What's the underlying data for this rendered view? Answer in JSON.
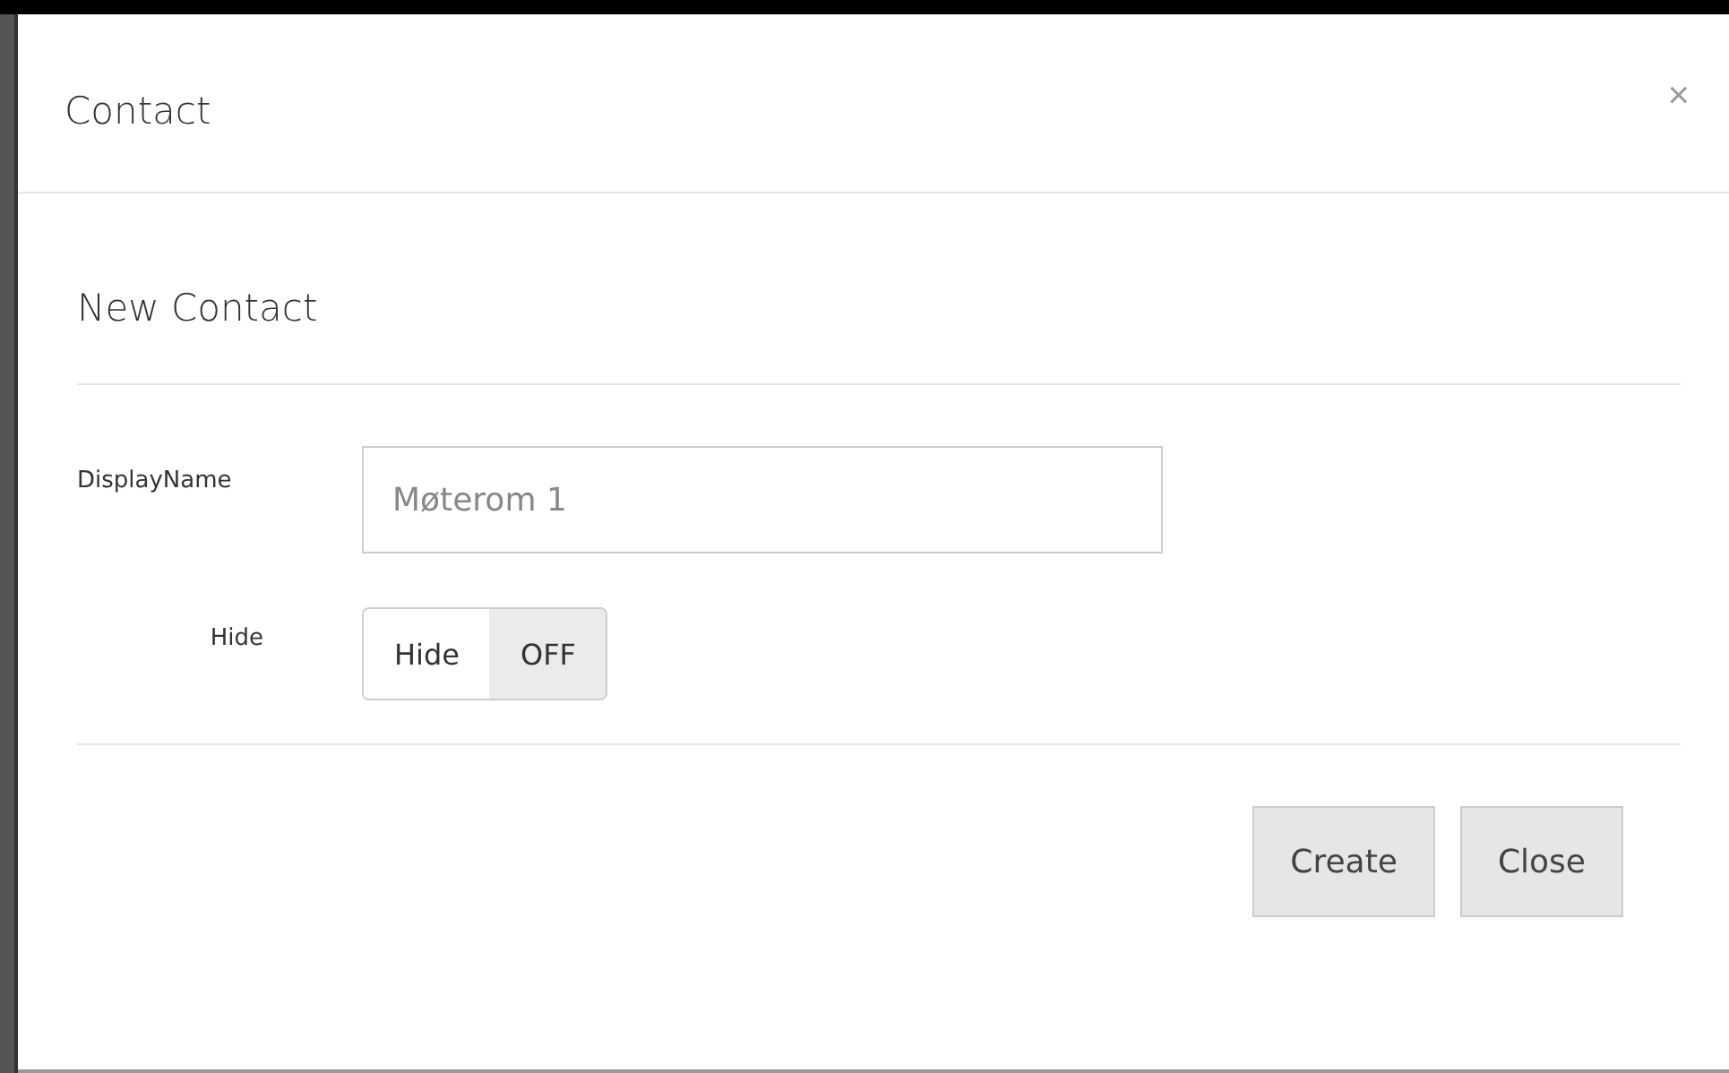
{
  "dialog": {
    "title": "Contact",
    "close": "×",
    "section_title": "New Contact",
    "fields": [
      {
        "kind": "text",
        "label": "DisplayName",
        "placeholder": "Møterom 1"
      },
      {
        "kind": "toggle",
        "label": "Hide",
        "toggle_label": "Hide",
        "state_text": "OFF",
        "on": false
      }
    ],
    "buttons": [
      "Create",
      "Close"
    ]
  }
}
